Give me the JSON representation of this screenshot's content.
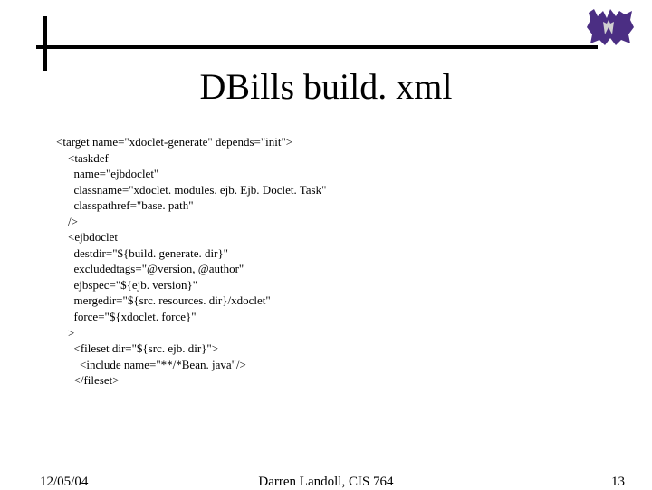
{
  "slide": {
    "title": "DBills build. xml",
    "code": "<target name=\"xdoclet-generate\" depends=\"init\">\n    <taskdef\n      name=\"ejbdoclet\"\n      classname=\"xdoclet. modules. ejb. Ejb. Doclet. Task\"\n      classpathref=\"base. path\"\n    />\n    <ejbdoclet\n      destdir=\"${build. generate. dir}\"\n      excludedtags=\"@version, @author\"\n      ejbspec=\"${ejb. version}\"\n      mergedir=\"${src. resources. dir}/xdoclet\"\n      force=\"${xdoclet. force}\"\n    >\n      <fileset dir=\"${src. ejb. dir}\">\n        <include name=\"**/*Bean. java\"/>\n      </fileset>"
  },
  "footer": {
    "date": "12/05/04",
    "center": "Darren Landoll, CIS 764",
    "page": "13"
  }
}
